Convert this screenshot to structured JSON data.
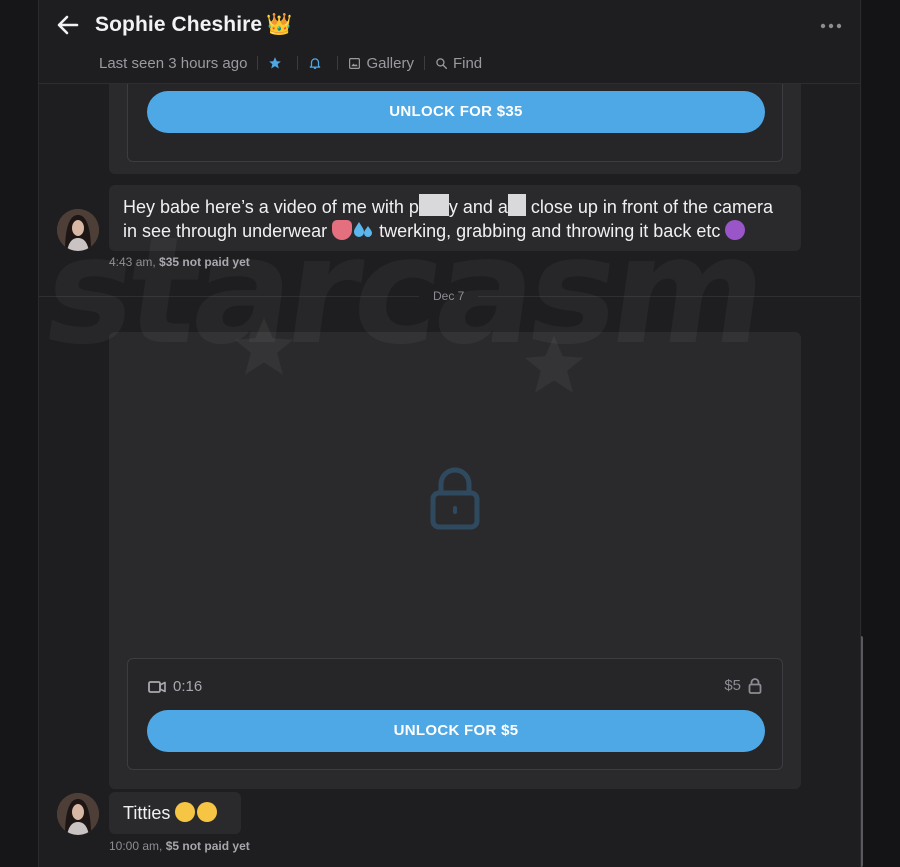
{
  "header": {
    "contact_name": "Sophie Cheshire",
    "crown_emoji": "👑",
    "last_seen": "Last seen 3 hours ago",
    "gallery_label": "Gallery",
    "find_label": "Find"
  },
  "messages": {
    "top_media": {
      "unlock_label": "UNLOCK FOR $35"
    },
    "first_text": {
      "part1": "Hey babe here’s a video of me with p",
      "part2": "y and a",
      "part3": " close up in front of the camera",
      "part4": "in see through underwear ",
      "part5": " twerking, grabbing and throwing it back etc ",
      "time": "4:43 am,",
      "price_status": "$35 not paid yet"
    },
    "date_divider": "Dec 7",
    "locked_media": {
      "duration": "0:16",
      "price": "$5",
      "unlock_label": "UNLOCK FOR $5"
    },
    "second_text": {
      "text": "Titties ",
      "time": "10:00 am,",
      "price_status": "$5 not paid yet"
    }
  },
  "watermark": "starcasm",
  "colors": {
    "accent": "#4fa8e6",
    "background": "#1e1e20",
    "bubble": "#2a2a2d"
  },
  "icons": [
    "back-arrow-icon",
    "crown-icon",
    "more-options-icon",
    "star-icon",
    "bell-icon",
    "gallery-icon",
    "search-icon",
    "lock-icon",
    "video-camera-icon"
  ]
}
